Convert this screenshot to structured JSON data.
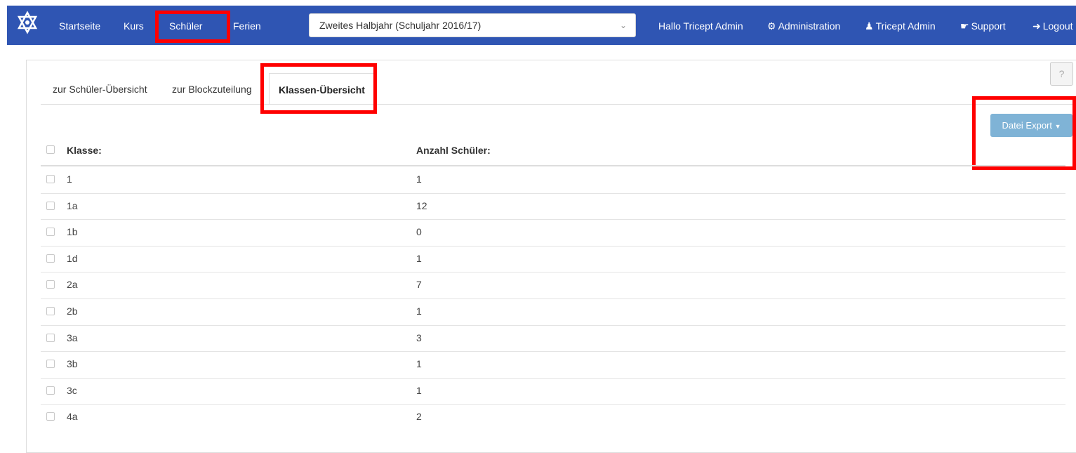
{
  "navbar": {
    "items": [
      {
        "label": "Startseite"
      },
      {
        "label": "Kurs"
      },
      {
        "label": "Schüler"
      },
      {
        "label": "Ferien"
      }
    ],
    "term_select": {
      "value": "Zweites Halbjahr (Schuljahr 2016/17)"
    },
    "greeting": "Hallo Tricept Admin",
    "administration": {
      "label": "Administration",
      "icon": "gear-icon"
    },
    "user": {
      "label": "Tricept Admin",
      "icon": "user-icon"
    },
    "support": {
      "label": "Support",
      "icon": "handshake-icon"
    },
    "logout": {
      "label": "Logout",
      "icon": "logout-icon"
    },
    "color": "#2f55b3"
  },
  "tabs": [
    {
      "label": "zur Schüler-Übersicht"
    },
    {
      "label": "zur Blockzuteilung"
    },
    {
      "label": "Klassen-Übersicht",
      "active": true
    }
  ],
  "help": {
    "label": "?"
  },
  "export": {
    "label": "Datei Export",
    "icon": "caret-down-icon",
    "color": "#7fb3d6"
  },
  "table": {
    "headers": [
      "Klasse:",
      "Anzahl Schüler:"
    ],
    "rows": [
      {
        "klasse": "1",
        "anzahl": "1"
      },
      {
        "klasse": "1a",
        "anzahl": "12"
      },
      {
        "klasse": "1b",
        "anzahl": "0"
      },
      {
        "klasse": "1d",
        "anzahl": "1"
      },
      {
        "klasse": "2a",
        "anzahl": "7"
      },
      {
        "klasse": "2b",
        "anzahl": "1"
      },
      {
        "klasse": "3a",
        "anzahl": "3"
      },
      {
        "klasse": "3b",
        "anzahl": "1"
      },
      {
        "klasse": "3c",
        "anzahl": "1"
      },
      {
        "klasse": "4a",
        "anzahl": "2"
      }
    ]
  },
  "highlight_color": "#ff0000"
}
